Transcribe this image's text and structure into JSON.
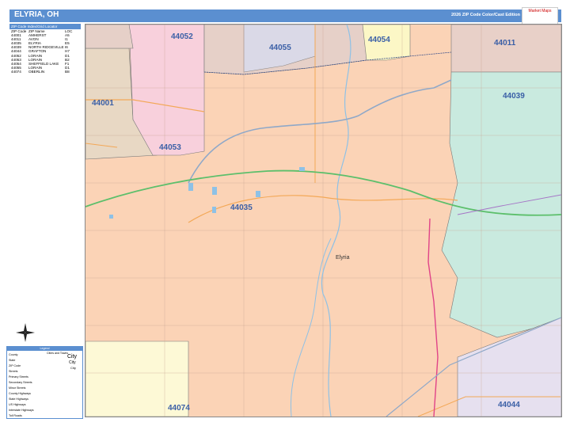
{
  "header": {
    "title": "ELYRIA, OH",
    "edition": "2026 ZIP Code Color/Cast Edition",
    "logo_text": "Market Maps"
  },
  "zip_table": {
    "caption": "ZIP Code Index/Grid Locator",
    "columns": [
      "ZIP Code",
      "ZIP Name",
      "LOC"
    ],
    "rows": [
      [
        "44001",
        "AMHERST",
        "A5"
      ],
      [
        "44011",
        "AVON",
        "I1"
      ],
      [
        "44035",
        "ELYRIA",
        "E5"
      ],
      [
        "44039",
        "NORTH RIDGEVILLE",
        "I6"
      ],
      [
        "44044",
        "GRAFTON",
        "H7"
      ],
      [
        "44052",
        "LORAIN",
        "D1"
      ],
      [
        "44053",
        "LORAIN",
        "B2"
      ],
      [
        "44054",
        "SHEFFIELD LAKE",
        "F1"
      ],
      [
        "44055",
        "LORAIN",
        "D1"
      ],
      [
        "44074",
        "OBERLIN",
        "B8"
      ]
    ]
  },
  "map": {
    "city_name": "Elyria",
    "zip_labels": [
      "44052",
      "44055",
      "44054",
      "44011",
      "44001",
      "44039",
      "44053",
      "44035",
      "44074",
      "44044"
    ],
    "zone_colors": {
      "44035": "#fbd3b6",
      "44001": "#e8d8c4",
      "44053": "#f8d0dc",
      "44052": "#e6d0c8",
      "44055": "#d8dcef",
      "44054": "#fcf7c6",
      "44011": "#e8d0c8",
      "44039": "#c9eadf",
      "44074": "#fdf9d6",
      "44044": "#e6e0ef"
    }
  },
  "legend": {
    "title": "Legend",
    "col_header": "Cities and Towns",
    "items": [
      "County",
      "State",
      "ZIP Code",
      "Streets",
      "Primary Streets",
      "Secondary Streets",
      "Minor Streets",
      "County Highways",
      "State Highways",
      "US Highways",
      "Interstate Highways",
      "Toll Roads"
    ],
    "city_samples": [
      "City",
      "City",
      "City"
    ]
  }
}
